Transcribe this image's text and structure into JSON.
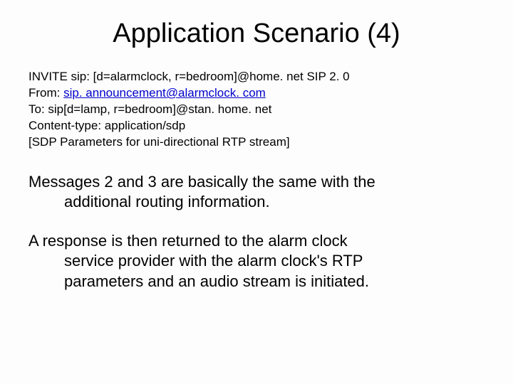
{
  "title": "Application Scenario (4)",
  "sip": {
    "invite": "INVITE sip: [d=alarmclock, r=bedroom]@home. net SIP  2. 0",
    "from_prefix": "From: ",
    "from_link": "sip. announcement@alarmclock. com",
    "to": "To: sip[d=lamp, r=bedroom]@stan. home. net",
    "content_type": "Content-type: application/sdp",
    "sdp": "[SDP Parameters for uni-directional RTP stream]"
  },
  "para1_line1": "Messages 2 and 3 are basically the same with the",
  "para1_line2": "additional routing information.",
  "para2_line1": "A response is then returned to the alarm clock",
  "para2_line2": "service provider with the alarm clock's RTP",
  "para2_line3": "parameters and an audio stream is initiated."
}
